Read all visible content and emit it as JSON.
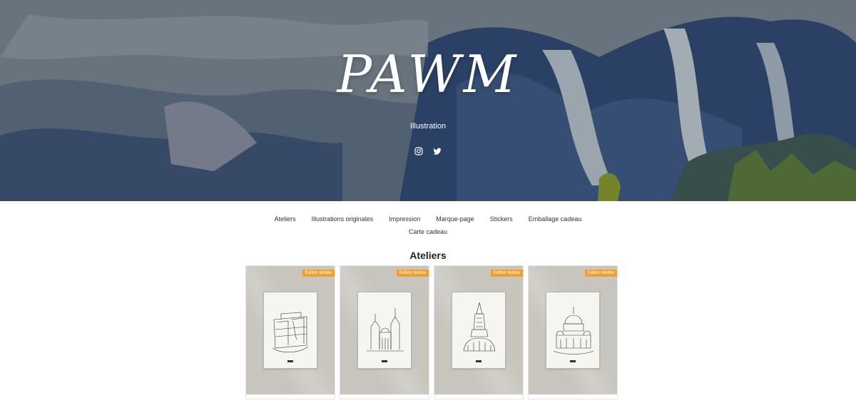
{
  "brand": {
    "title": "PAWM",
    "tagline": "Illustration"
  },
  "socials": [
    {
      "icon": "instagram-icon"
    },
    {
      "icon": "twitter-icon"
    }
  ],
  "nav": {
    "row1": [
      "Ateliers",
      "Illustrations originales",
      "Impression",
      "Marque-page",
      "Stickers",
      "Emballage cadeau"
    ],
    "row2": [
      "Carte cadeau"
    ]
  },
  "section": {
    "title": "Ateliers"
  },
  "products": [
    {
      "badge": "Edition limitée",
      "subject": "building-sketch"
    },
    {
      "badge": "Edition limitée",
      "subject": "basilica-sketch"
    },
    {
      "badge": "Edition limitée",
      "subject": "church-tower-sketch"
    },
    {
      "badge": "Edition limitée",
      "subject": "domed-basilica-sketch"
    }
  ],
  "colors": {
    "badge": "#f0a030",
    "card_bg": "#c7c5bd",
    "hero_dark": "#2f4a73"
  }
}
